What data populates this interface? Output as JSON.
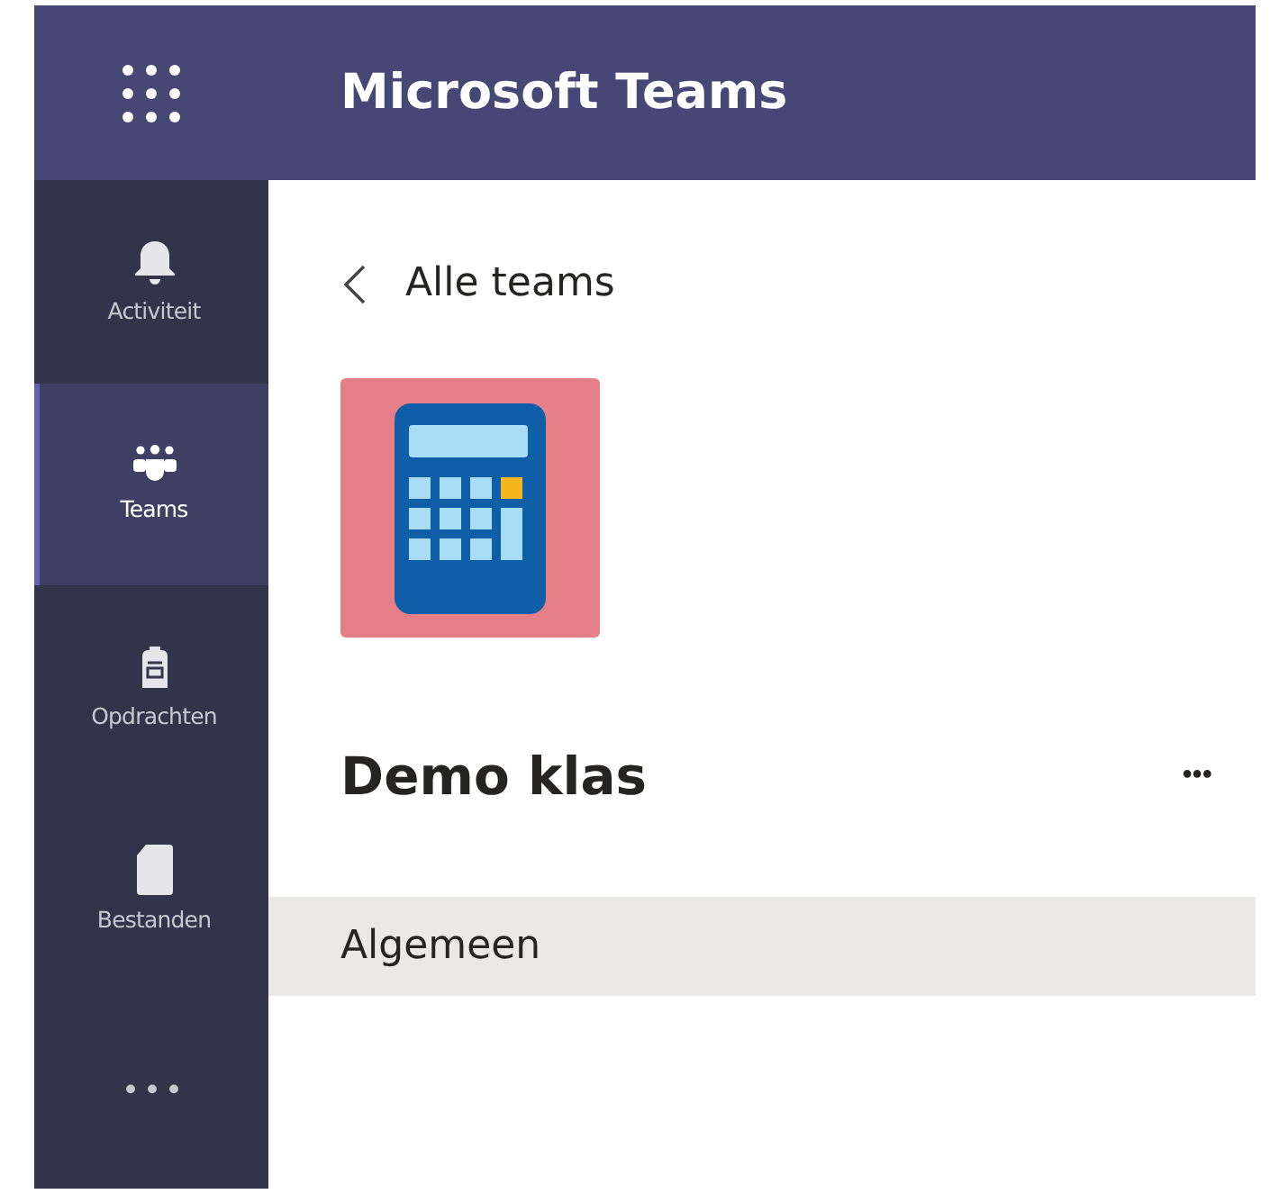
{
  "app_bar": {
    "title": "Microsoft Teams"
  },
  "rail": [
    {
      "kind": "bell",
      "label": "Activiteit",
      "selected": false
    },
    {
      "kind": "teams",
      "label": "Teams",
      "selected": true
    },
    {
      "kind": "backpack",
      "label": "Opdrachten",
      "selected": false
    },
    {
      "kind": "file",
      "label": "Bestanden",
      "selected": false
    },
    {
      "kind": "more",
      "label": "•••",
      "selected": false
    }
  ],
  "back_link": "Alle teams",
  "team": {
    "name": "Demo klas",
    "more": "•••"
  },
  "channels": [
    {
      "name": "Algemeen",
      "selected": true
    }
  ]
}
